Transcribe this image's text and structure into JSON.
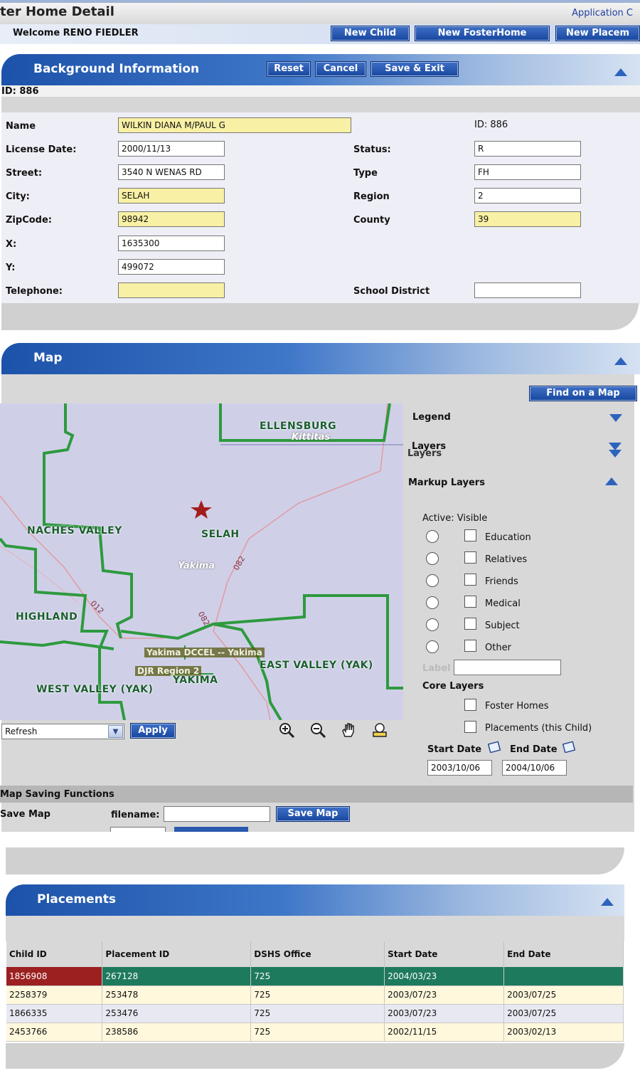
{
  "header": {
    "title": "ter Home Detail",
    "app_link": "Application C",
    "welcome": "Welcome RENO FIEDLER",
    "buttons": [
      "New Child",
      "New FosterHome",
      "New Placem"
    ]
  },
  "background": {
    "title": "Background Information",
    "buttons": {
      "reset": "Reset",
      "cancel": "Cancel",
      "save_exit": "Save & Exit"
    },
    "id_line": "ID: 886",
    "id_right": "ID: 886",
    "fields_left": [
      {
        "label": "Name",
        "value": "WILKIN DIANA M/PAUL G",
        "required": true
      },
      {
        "label": "License Date:",
        "value": "2000/11/13",
        "required": false
      },
      {
        "label": "Street:",
        "value": "3540 N WENAS RD",
        "required": false
      },
      {
        "label": "City:",
        "value": "SELAH",
        "required": true
      },
      {
        "label": "ZipCode:",
        "value": "98942",
        "required": true
      },
      {
        "label": "X:",
        "value": "1635300",
        "required": false
      },
      {
        "label": "Y:",
        "value": "499072",
        "required": false
      },
      {
        "label": "Telephone:",
        "value": "",
        "required": true
      }
    ],
    "fields_right": [
      {
        "label": "Status:",
        "value": "R",
        "required": false
      },
      {
        "label": "Type",
        "value": "FH",
        "required": false
      },
      {
        "label": "Region",
        "value": "2",
        "required": false
      },
      {
        "label": "County",
        "value": "39",
        "required": true
      },
      {
        "label": "School District",
        "value": "",
        "required": false
      }
    ]
  },
  "map": {
    "title": "Map",
    "find_button": "Find on a Map",
    "labels": {
      "ellensburg": "ELLENSBURG",
      "kittitas": "Kittitas",
      "naches_valley": "NACHES VALLEY",
      "selah": "SELAH",
      "yakima_county": "Yakima",
      "highland": "HIGHLAND",
      "dccel": "Yakima DCCEL -- Yakima",
      "djr": "DJR Region 2",
      "yakima": "YAKIMA",
      "east_valley": "EAST VALLEY (YAK)",
      "west_valley": "WEST VALLEY (YAK)",
      "route_082a": "082",
      "route_082b": "082",
      "route_012": "012"
    },
    "refresh_select": "Refresh",
    "apply_button": "Apply",
    "panel": {
      "legend": "Legend",
      "layers": "Layers",
      "layers_ghost": "Layers",
      "markup_layers": "Markup Layers",
      "active_visible": "Active: Visible",
      "markup_items": [
        "Education",
        "Relatives",
        "Friends",
        "Medical",
        "Subject",
        "Other"
      ],
      "label_field": "Label",
      "core_layers": "Core Layers",
      "core_items": [
        "Foster Homes",
        "Placements (this Child)"
      ],
      "start_date_label": "Start Date",
      "end_date_label": "End Date",
      "start_date": "2003/10/06",
      "end_date": "2004/10/06"
    },
    "saving": {
      "title": "Map Saving Functions",
      "save_map_label": "Save Map",
      "filename_label": "filename:",
      "save_button": "Save Map"
    },
    "colors": {
      "boundary": "#2e9a3e",
      "star": "#a31c1c",
      "road": "#e39aa0"
    }
  },
  "placements": {
    "title": "Placements",
    "columns": [
      "Child ID",
      "Placement ID",
      "DSHS Office",
      "Start Date",
      "End Date"
    ],
    "rows": [
      [
        "1856908",
        "267128",
        "725",
        "2004/03/23",
        ""
      ],
      [
        "2258379",
        "253478",
        "725",
        "2003/07/23",
        "2003/07/25"
      ],
      [
        "1866335",
        "253476",
        "725",
        "2003/07/23",
        "2003/07/25"
      ],
      [
        "2453766",
        "238586",
        "725",
        "2002/11/15",
        "2003/02/13"
      ]
    ]
  }
}
